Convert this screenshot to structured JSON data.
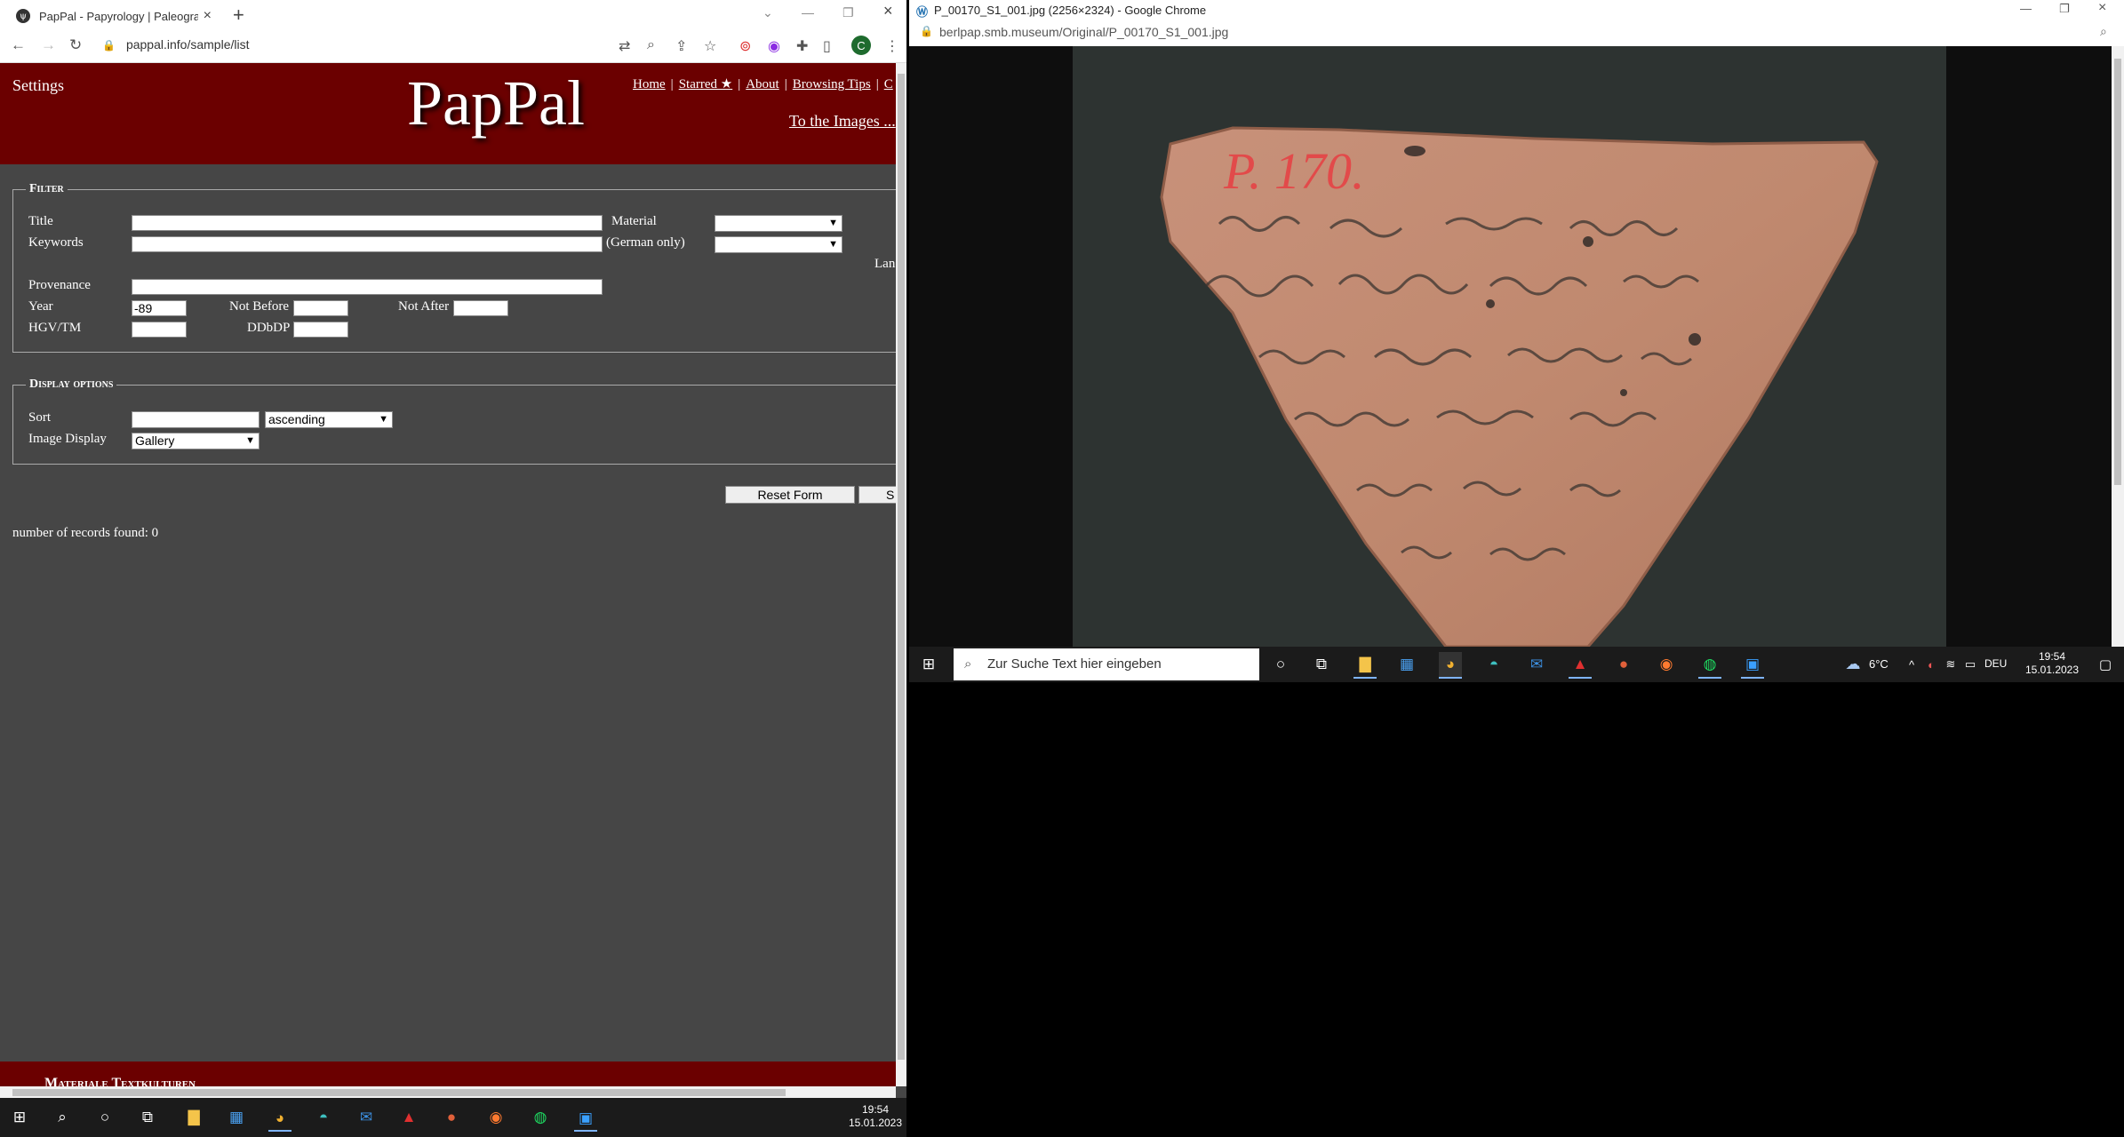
{
  "left_window": {
    "tab_title": "PapPal - Papyrology | Paleograph",
    "tab_favicon": "ψ",
    "url": "pappal.info/sample/list",
    "profile_initial": "C",
    "site": {
      "settings": "Settings",
      "logo": "PapPal",
      "nav": {
        "home": "Home",
        "starred": "Starred ★",
        "about": "About",
        "browsing_tips": "Browsing Tips",
        "truncated": "C"
      },
      "to_images": "To the Images ..."
    },
    "filter": {
      "legend": "Filter",
      "title_label": "Title",
      "title_value": "",
      "keywords_label": "Keywords",
      "keywords_value": "",
      "material_label": "Material",
      "german_only_label": "(German only)",
      "language_truncated": "Lan",
      "provenance_label": "Provenance",
      "provenance_value": "",
      "year_label": "Year",
      "year_value": "-89",
      "not_before_label": "Not Before",
      "not_after_label": "Not After",
      "hgv_label": "HGV/TM",
      "ddbdp_label": "DDbDP"
    },
    "display_options": {
      "legend": "Display options",
      "sort_label": "Sort",
      "sort_value": "",
      "order_value": "ascending",
      "image_display_label": "Image Display",
      "image_display_value": "Gallery"
    },
    "buttons": {
      "reset": "Reset Form",
      "submit_truncated": "S"
    },
    "records_text": "number of records found: 0",
    "footer_text": "Materiale Textkulturen"
  },
  "right_window": {
    "title": "P_00170_S1_001.jpg (2256×2324) - Google Chrome",
    "url": "berlpap.smb.museum/Original/P_00170_S1_001.jpg",
    "image_inscription": "P. 170."
  },
  "taskbar_left": {
    "time": "19:54",
    "date": "15.01.2023"
  },
  "taskbar_right": {
    "search_placeholder": "Zur Suche Text hier eingeben",
    "weather": "6°C",
    "language": "DEU",
    "time": "19:54",
    "date": "15.01.2023"
  },
  "colors": {
    "header_red": "#6b0000",
    "page_gray": "#464646"
  }
}
